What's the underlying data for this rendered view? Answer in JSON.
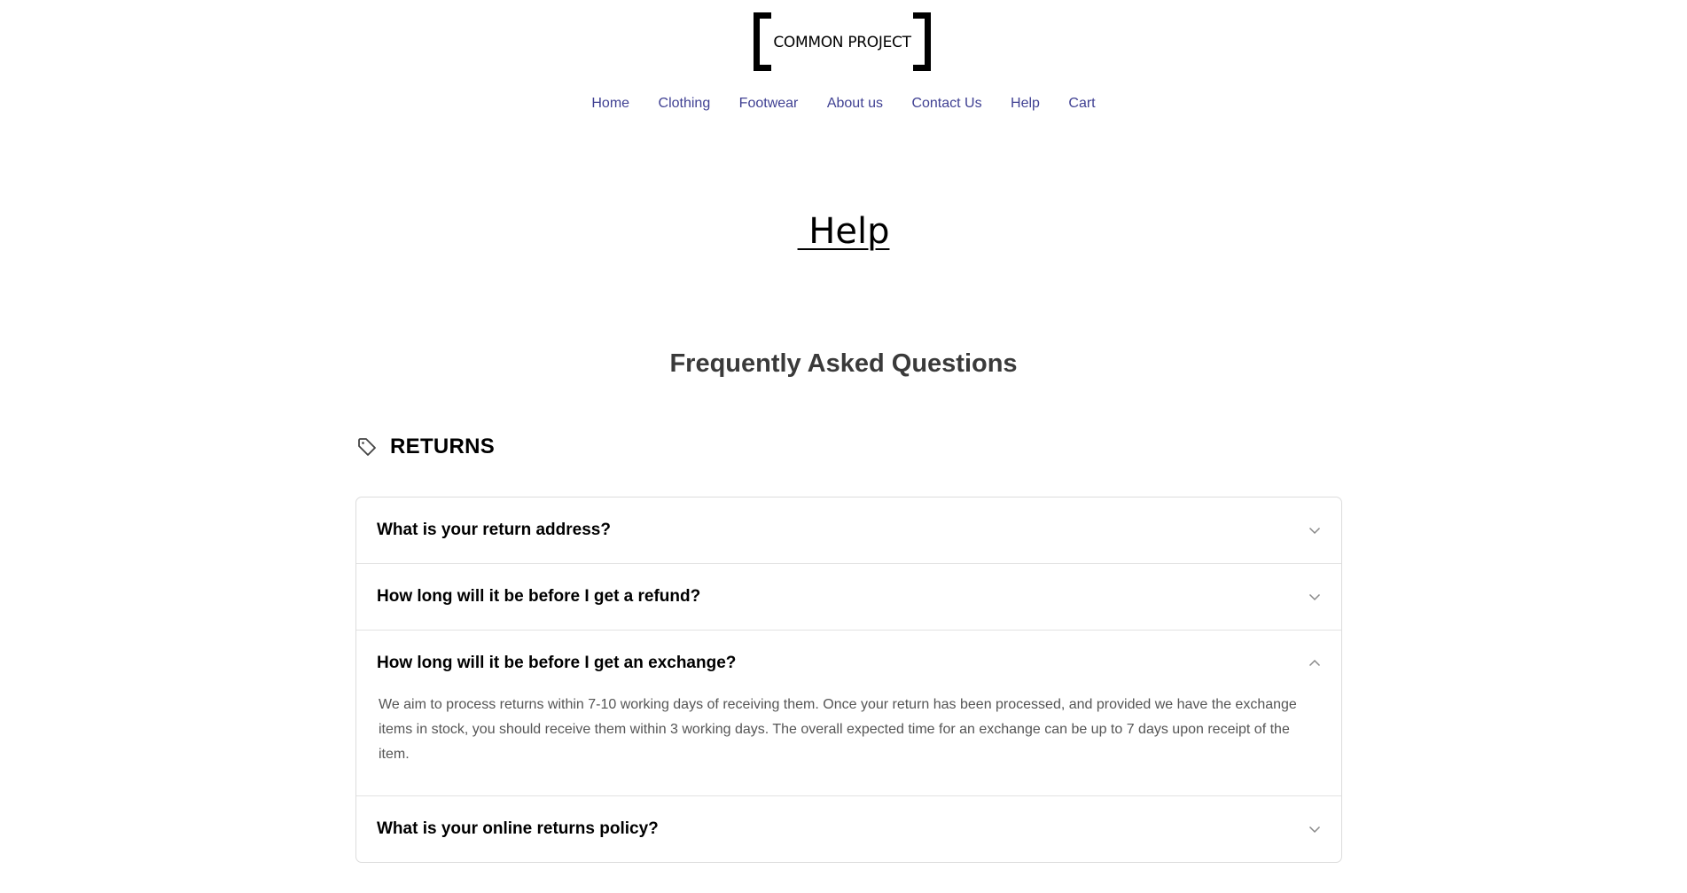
{
  "logo": {
    "text": "COMMON PROJECT"
  },
  "nav": {
    "items": [
      "Home",
      "Clothing",
      "Footwear",
      "About us",
      "Contact Us",
      "Help",
      "Cart"
    ]
  },
  "page_title": " Help",
  "faq_heading": "Frequently Asked Questions",
  "section": {
    "icon": "tag-icon",
    "title": "RETURNS"
  },
  "faq": [
    {
      "question": "What is your return address?",
      "expanded": false
    },
    {
      "question": "How long will it be before I get a refund?",
      "expanded": false
    },
    {
      "question": "How long will it be before I get an exchange?",
      "expanded": true,
      "answer": "We aim to process returns within 7-10 working days of receiving them. Once your return has been processed, and provided we have the exchange items in stock, you should receive them within 3 working days. The overall expected time for an exchange can be up to 7 days upon receipt of the item."
    },
    {
      "question": "What is your online returns policy?",
      "expanded": false
    }
  ],
  "colors": {
    "nav_link": "#404193",
    "heading": "#3a3a3a",
    "border": "#dcdcdc",
    "chevron": "#888888"
  }
}
